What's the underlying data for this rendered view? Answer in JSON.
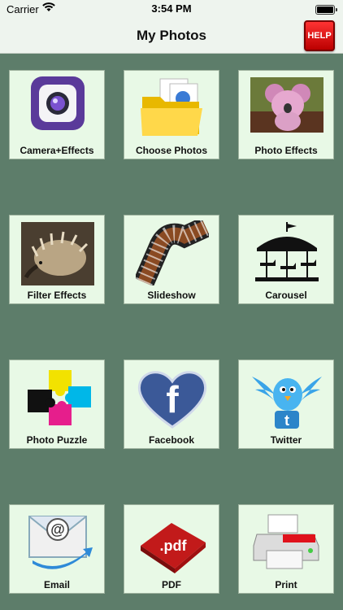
{
  "status_bar": {
    "carrier": "Carrier",
    "time": "3:54 PM"
  },
  "nav": {
    "title": "My Photos",
    "help_label": "HELP"
  },
  "tiles": [
    {
      "label": "Camera+Effects",
      "icon": "camera-icon"
    },
    {
      "label": "Choose Photos",
      "icon": "folder-photos-icon"
    },
    {
      "label": "Photo Effects",
      "icon": "koala-photo-icon"
    },
    {
      "label": "Filter Effects",
      "icon": "echidna-photo-icon"
    },
    {
      "label": "Slideshow",
      "icon": "film-strip-icon"
    },
    {
      "label": "Carousel",
      "icon": "carousel-icon"
    },
    {
      "label": "Photo Puzzle",
      "icon": "puzzle-icon"
    },
    {
      "label": "Facebook",
      "icon": "facebook-heart-icon"
    },
    {
      "label": "Twitter",
      "icon": "twitter-bird-icon"
    },
    {
      "label": "Email",
      "icon": "email-envelope-icon"
    },
    {
      "label": "PDF",
      "icon": "pdf-icon"
    },
    {
      "label": "Print",
      "icon": "printer-icon"
    }
  ],
  "colors": {
    "background": "#5d7d6a",
    "tile": "#e8f9e6",
    "help": "#d01010"
  }
}
